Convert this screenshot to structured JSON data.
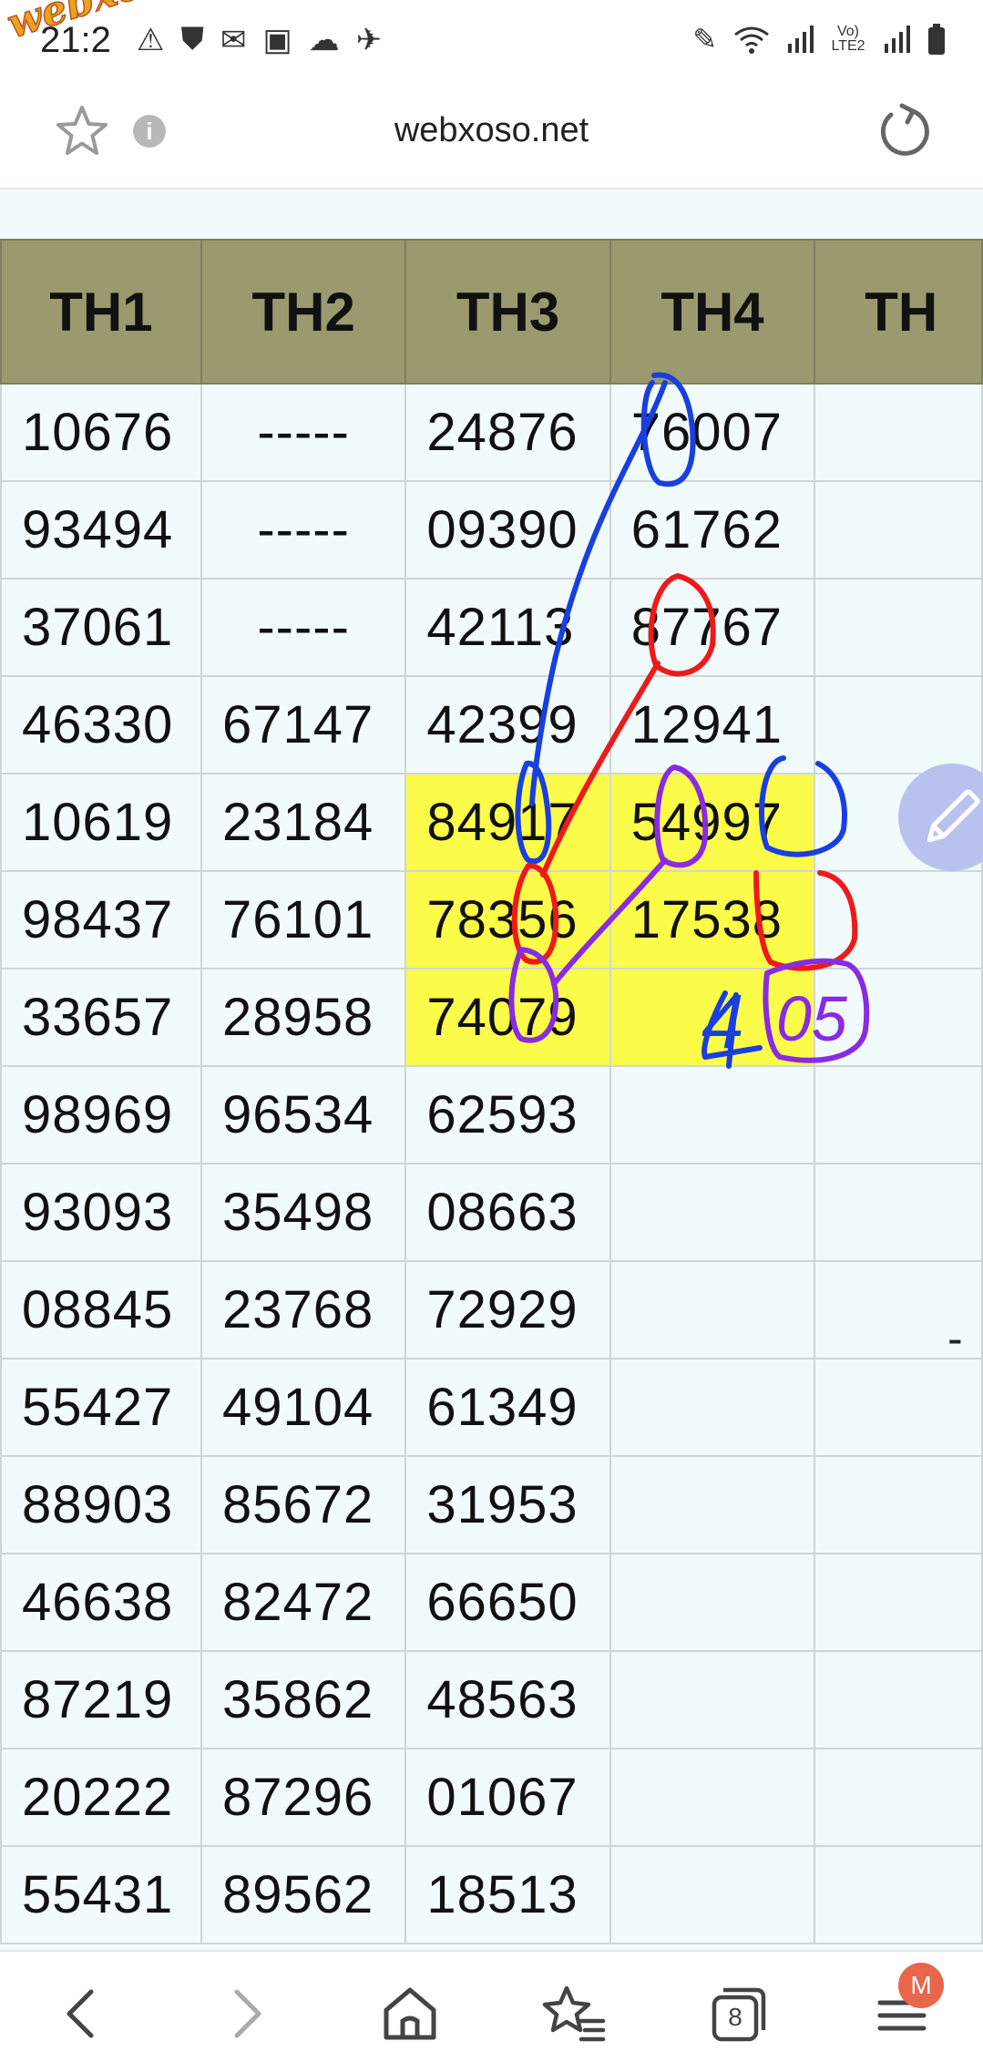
{
  "status_bar": {
    "time": "21:2",
    "left_icons": [
      "warning-icon",
      "shield-icon",
      "gmail-icon",
      "gallery-icon",
      "cloud-icon",
      "vpn-icon"
    ],
    "right_icons": [
      "pen-icon",
      "wifi-icon",
      "signal-icon",
      "volte-icon",
      "signal-icon",
      "battery-icon"
    ],
    "volte_label": "Vo) LTE2"
  },
  "watermark": {
    "text": "webxoso.net"
  },
  "browser": {
    "url": "webxoso.net",
    "info_glyph": "i"
  },
  "table": {
    "headers": [
      "TH1",
      "TH2",
      "TH3",
      "TH4",
      "TH"
    ],
    "rows": [
      [
        "10676",
        "-----",
        "24876",
        "76007",
        ""
      ],
      [
        "93494",
        "-----",
        "09390",
        "61762",
        ""
      ],
      [
        "37061",
        "-----",
        "42113",
        "87767",
        ""
      ],
      [
        "46330",
        "67147",
        "42399",
        "12941",
        ""
      ],
      [
        "10619",
        "23184",
        "84917",
        "54997",
        ""
      ],
      [
        "98437",
        "76101",
        "78356",
        "17538",
        ""
      ],
      [
        "33657",
        "28958",
        "74079",
        "",
        ""
      ],
      [
        "98969",
        "96534",
        "62593",
        "",
        ""
      ],
      [
        "93093",
        "35498",
        "08663",
        "",
        ""
      ],
      [
        "08845",
        "23768",
        "72929",
        "",
        ""
      ],
      [
        "55427",
        "49104",
        "61349",
        "",
        ""
      ],
      [
        "88903",
        "85672",
        "31953",
        "",
        ""
      ],
      [
        "46638",
        "82472",
        "66650",
        "",
        ""
      ],
      [
        "87219",
        "35862",
        "48563",
        "",
        ""
      ],
      [
        "20222",
        "87296",
        "01067",
        "",
        ""
      ],
      [
        "55431",
        "89562",
        "18513",
        "",
        ""
      ]
    ],
    "highlighted_cells": [
      [
        4,
        2
      ],
      [
        5,
        2
      ],
      [
        6,
        2
      ],
      [
        4,
        3
      ],
      [
        5,
        3
      ],
      [
        6,
        3
      ]
    ],
    "header_color": "#9b9a6f",
    "highlight_color": "#fbfb4a",
    "row_background": "#f1fbfc"
  },
  "side_mark": "-",
  "annotations": {
    "handwritten_number": "4",
    "handwritten_boxed": "05",
    "colors": {
      "blue": "#1a3fe0",
      "red": "#ee1a1a",
      "purple": "#8a2be2"
    }
  },
  "bottom_nav": {
    "tabs_count": "8",
    "menu_badge": "M",
    "icons": [
      "back-icon",
      "forward-icon",
      "home-icon",
      "bookmarks-icon",
      "tabs-icon",
      "menu-icon"
    ]
  }
}
